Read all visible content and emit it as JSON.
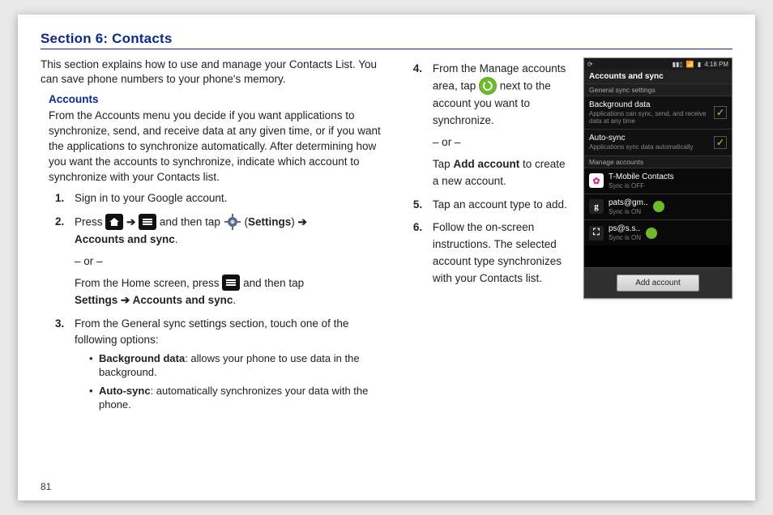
{
  "section_title": "Section 6: Contacts",
  "intro": "This section explains how to use and manage your Contacts List. You can save phone numbers to your phone's memory.",
  "accounts": {
    "heading": "Accounts",
    "desc": "From the Accounts menu you decide if you want applications to synchronize, send, and receive data at any given time, or if you want the applications to synchronize automatically. After determining how you want the accounts to synchronize, indicate which account to synchronize with your Contacts list.",
    "step1": "Sign in to your Google account.",
    "step2_a": "Press ",
    "step2_b": " and then tap ",
    "settings_label": "Settings",
    "arrow": "➔",
    "step2_c": "Accounts and sync",
    "or": "– or –",
    "step2_alt_a": "From the Home screen, press ",
    "step2_alt_b": " and then tap",
    "step2_alt_c": "Settings ➔ Accounts and sync",
    "step3": "From the General sync settings section, touch one of the following options:",
    "bullet1_bold": "Background data",
    "bullet1_rest": ": allows your phone to use data in the background.",
    "bullet2_bold": "Auto-sync",
    "bullet2_rest": ": automatically synchronizes your data with the phone."
  },
  "right": {
    "step4_a": "From the Manage accounts area, tap ",
    "step4_b": " next to the account you want to synchronize.",
    "or": "– or –",
    "step4_alt_a": "Tap ",
    "step4_alt_bold": "Add account",
    "step4_alt_b": " to create a new account.",
    "step5": "Tap an account type to add.",
    "step6": "Follow the on-screen instructions. The selected account type synchronizes with your Contacts list."
  },
  "phone": {
    "time": "4:18 PM",
    "title": "Accounts and sync",
    "subtitle": "General sync settings",
    "row1": {
      "title": "Background data",
      "sub": "Applications can sync, send, and receive data at any time"
    },
    "row2": {
      "title": "Auto-sync",
      "sub": "Applications sync data automatically"
    },
    "manage_label": "Manage accounts",
    "accounts": [
      {
        "name": "T-Mobile Contacts",
        "sub": "Sync is OFF",
        "icon": "tm",
        "glyph": "✿",
        "sync": false
      },
      {
        "name": "pats@gm..",
        "sub": "Sync is ON",
        "icon": "gl",
        "glyph": "g",
        "sync": true
      },
      {
        "name": "ps@s.s..",
        "sub": "Sync is ON",
        "icon": "sq",
        "glyph": "⛶",
        "sync": true
      }
    ],
    "add_button": "Add account"
  },
  "page_number": "81"
}
